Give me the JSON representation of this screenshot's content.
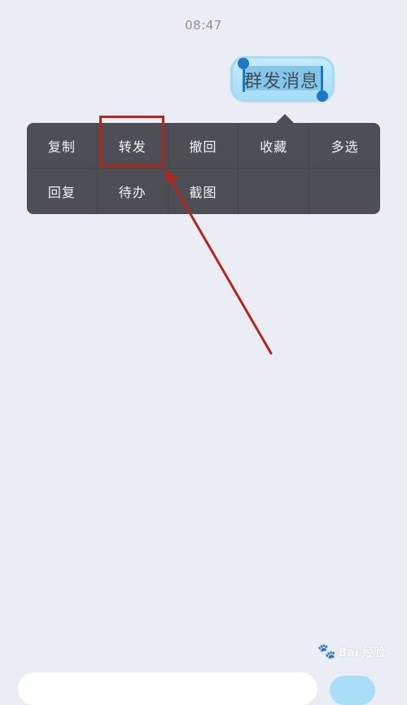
{
  "status": {
    "time": "08:47"
  },
  "message": {
    "text": "群发消息",
    "bubble_color": "#a4dcf8",
    "selection_handle_color": "#1e78c8"
  },
  "context_menu": {
    "background": "#4d4f54",
    "items": [
      {
        "label": "复制"
      },
      {
        "label": "转发"
      },
      {
        "label": "撤回"
      },
      {
        "label": "收藏"
      },
      {
        "label": "多选"
      },
      {
        "label": "回复"
      },
      {
        "label": "待办"
      },
      {
        "label": "截图"
      }
    ]
  },
  "annotation": {
    "highlighted_item": "转发",
    "color": "#b3261e"
  },
  "watermark": {
    "text": "Bai 经验",
    "icon": "paw-icon"
  }
}
